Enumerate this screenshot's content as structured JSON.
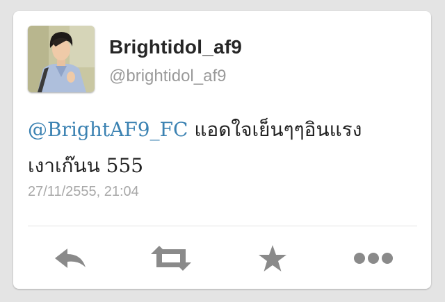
{
  "tweet": {
    "display_name": "Brightidol_af9",
    "handle": "@brightidol_af9",
    "mention": "@BrightAF9_FC",
    "body_line1": "แอดใจเย็นๆๆอินแรง",
    "body_line2": "เงาเก๊นน 555",
    "timestamp": "27/11/2555, 21:04"
  },
  "actions": [
    {
      "name": "reply",
      "icon": "reply-icon"
    },
    {
      "name": "retweet",
      "icon": "retweet-icon"
    },
    {
      "name": "favorite",
      "icon": "star-icon"
    },
    {
      "name": "more",
      "icon": "more-dots-icon"
    }
  ],
  "colors": {
    "mention": "#3b82b2",
    "icon": "#8a8a8a",
    "background": "#e4e4e4",
    "card": "#ffffff"
  }
}
